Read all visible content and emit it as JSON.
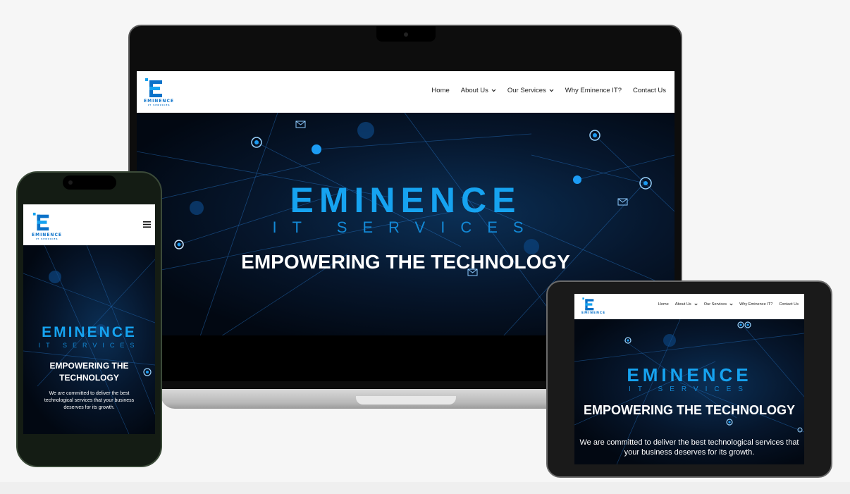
{
  "site": {
    "logo_text": "EMINENCE",
    "logo_subtext": "IT SERVICES",
    "brand_name": "EMINENCE",
    "brand_tagline": "IT SERVICES",
    "hero_heading": "EMPOWERING THE TECHNOLOGY",
    "hero_description": "We are committed to deliver the best technological services that your business deserves for its growth."
  },
  "nav": {
    "items": [
      {
        "label": "Home",
        "dropdown": false
      },
      {
        "label": "About Us",
        "dropdown": true
      },
      {
        "label": "Our Services",
        "dropdown": true
      },
      {
        "label": "Why Eminence IT?",
        "dropdown": false
      },
      {
        "label": "Contact Us",
        "dropdown": false
      }
    ],
    "menu_icon": "hamburger-icon"
  },
  "colors": {
    "accent": "#16a3f0",
    "logo_blue": "#0b72c9",
    "hero_bg": "#020812",
    "header_bg": "#ffffff"
  }
}
